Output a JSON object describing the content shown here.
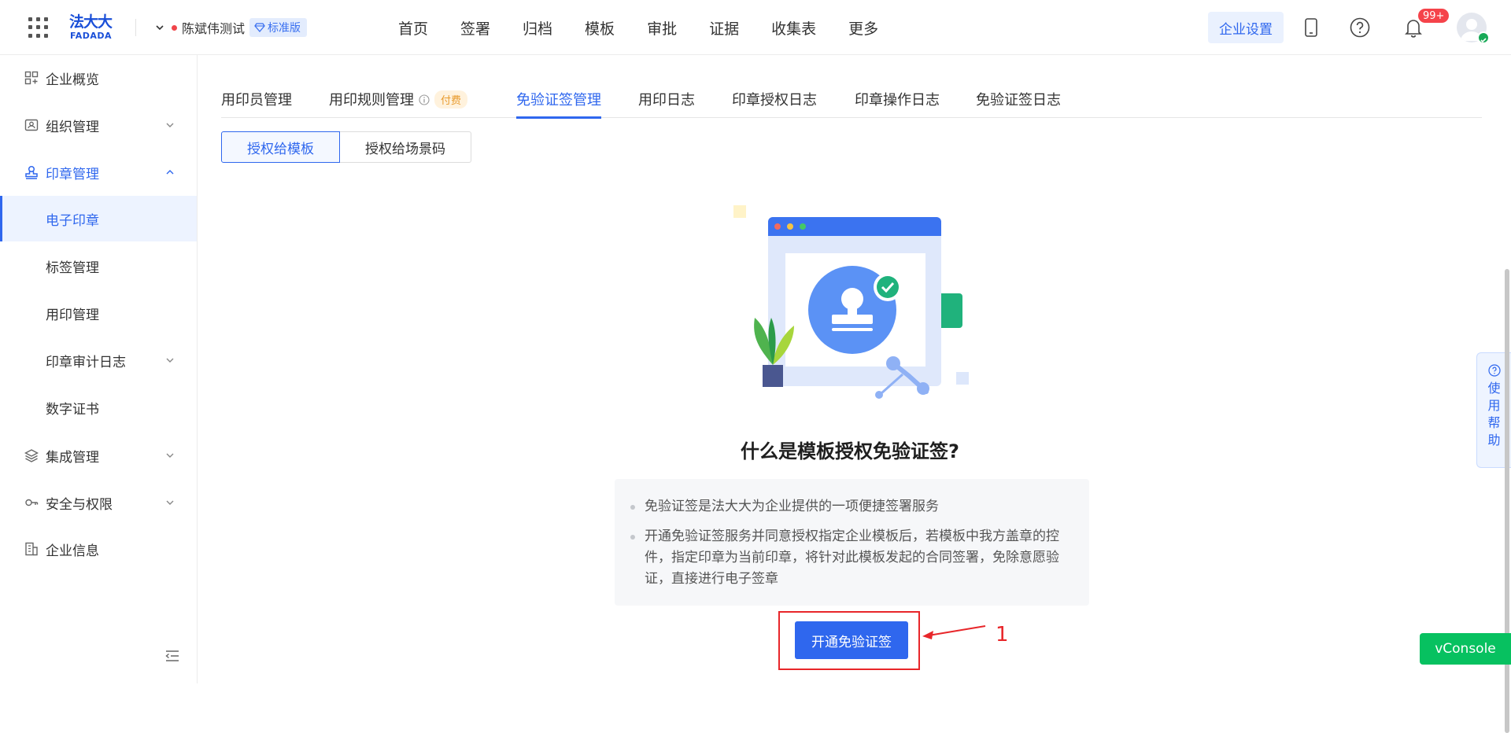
{
  "header": {
    "logo_cn": "法大大",
    "logo_en": "FADADA",
    "org_name": "陈斌伟测试",
    "edition": "标准版",
    "nav": [
      "首页",
      "签署",
      "归档",
      "模板",
      "审批",
      "证据",
      "收集表",
      "更多"
    ],
    "settings_label": "企业设置",
    "notification_badge": "99+"
  },
  "sidebar": {
    "items": [
      {
        "label": "企业概览",
        "icon": "dashboard-icon"
      },
      {
        "label": "组织管理",
        "icon": "org-icon"
      },
      {
        "label": "印章管理",
        "icon": "seal-icon"
      },
      {
        "label": "电子印章"
      },
      {
        "label": "标签管理"
      },
      {
        "label": "用印管理"
      },
      {
        "label": "印章审计日志"
      },
      {
        "label": "数字证书"
      },
      {
        "label": "集成管理",
        "icon": "layers-icon"
      },
      {
        "label": "安全与权限",
        "icon": "key-icon"
      },
      {
        "label": "企业信息",
        "icon": "building-icon"
      }
    ],
    "active_item": "电子印章"
  },
  "tabs": {
    "items": [
      "用印员管理",
      "用印规则管理",
      "免验证签管理",
      "用印日志",
      "印章授权日志",
      "印章操作日志",
      "免验证签日志"
    ],
    "paid_tag": "付费",
    "active": "免验证签管理"
  },
  "segment": {
    "items": [
      "授权给模板",
      "授权给场景码"
    ],
    "active": "授权给模板"
  },
  "content": {
    "heading": "什么是模板授权免验证签?",
    "bullets": [
      "免验证签是法大大为企业提供的一项便捷签署服务",
      "开通免验证签服务并同意授权指定企业模板后，若模板中我方盖章的控件，指定印章为当前印章，将针对此模板发起的合同签署，免除意愿验证，直接进行电子签章"
    ],
    "enable_button": "开通免验证签",
    "annotation_number": "1"
  },
  "help_float": {
    "label": "使用帮助"
  },
  "vconsole": {
    "label": "vConsole"
  },
  "colors": {
    "primary": "#2f67ee",
    "annotation": "#e8262a",
    "vconsole": "#07c160",
    "badge": "#f5434a"
  }
}
